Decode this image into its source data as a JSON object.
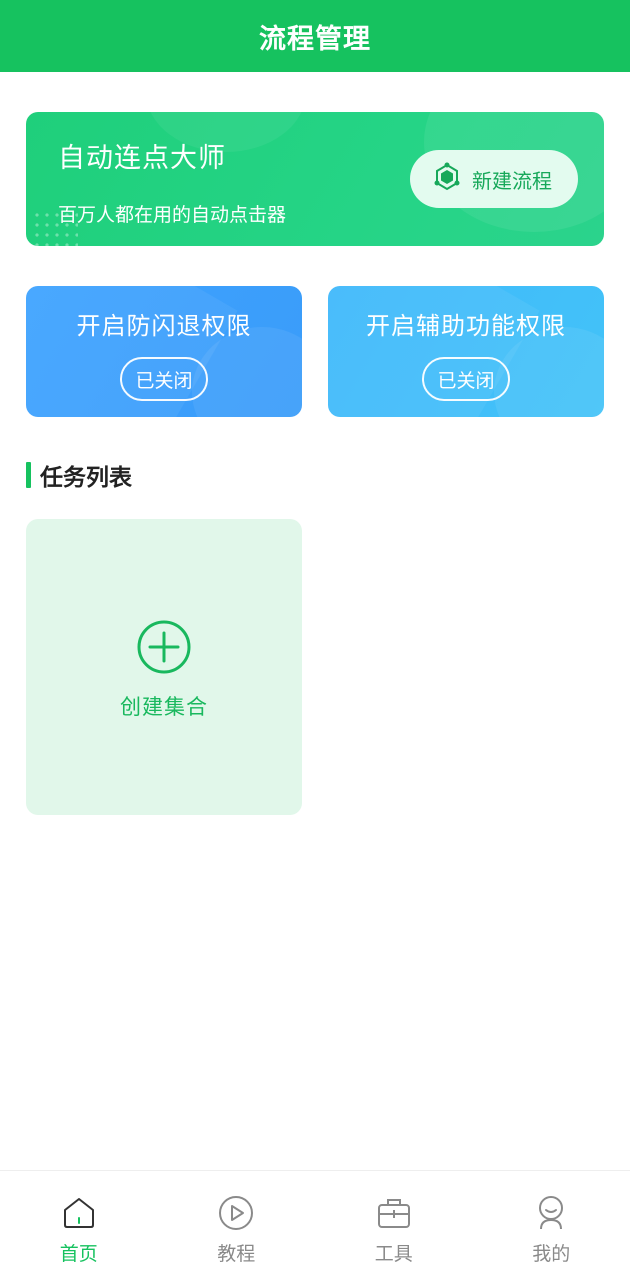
{
  "header": {
    "title": "流程管理"
  },
  "banner": {
    "app_name": "自动连点大师",
    "slogan": "百万人都在用的自动点击器",
    "new_flow_button": "新建流程"
  },
  "permissions": [
    {
      "title": "开启防闪退权限",
      "status": "已关闭"
    },
    {
      "title": "开启辅助功能权限",
      "status": "已关闭"
    }
  ],
  "task_section": {
    "heading": "任务列表",
    "create_label": "创建集合"
  },
  "tabbar": {
    "items": [
      {
        "label": "首页",
        "icon": "home-icon",
        "active": true
      },
      {
        "label": "教程",
        "icon": "play-circle-icon",
        "active": false
      },
      {
        "label": "工具",
        "icon": "toolbox-icon",
        "active": false
      },
      {
        "label": "我的",
        "icon": "user-icon",
        "active": false
      }
    ]
  },
  "colors": {
    "brand_green": "#16c25f",
    "blue_card": "#3a9cf9",
    "light_blue_card": "#43c3f8",
    "tab_inactive": "#8a8a8a"
  }
}
